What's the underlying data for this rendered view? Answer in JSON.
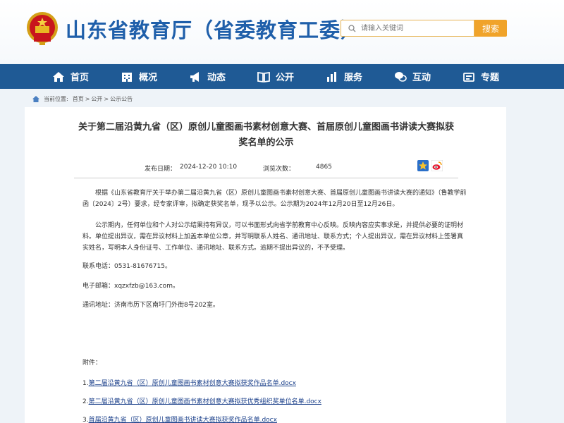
{
  "header": {
    "site_title": "山东省教育厅（省委教育工委）",
    "search_placeholder": "请输入关键词",
    "search_button": "搜索"
  },
  "nav": {
    "items": [
      {
        "label": "首页",
        "icon": "home-icon"
      },
      {
        "label": "概况",
        "icon": "building-icon"
      },
      {
        "label": "动态",
        "icon": "megaphone-icon"
      },
      {
        "label": "公开",
        "icon": "book-icon"
      },
      {
        "label": "服务",
        "icon": "chart-icon"
      },
      {
        "label": "互动",
        "icon": "chat-icon"
      },
      {
        "label": "专题",
        "icon": "flag-icon"
      }
    ]
  },
  "breadcrumb": {
    "prefix": "当前位置:",
    "items": [
      "首页",
      ">",
      "公开",
      ">",
      "公示公告"
    ]
  },
  "article": {
    "title": "关于第二届沿黄九省（区）原创儿童图画书素材创意大赛、首届原创儿童图画书讲读大赛拟获奖名单的公示",
    "date_label": "发布日期：",
    "date_value": "2024-12-20 10:10",
    "views_label": "浏览次数：",
    "views_value": "4865",
    "paragraphs": [
      "根据《山东省教育厅关于举办第二届沿黄九省（区）原创儿童图画书素材创意大赛、首届原创儿童图画书讲读大赛的通知》（鲁教学前函〔2024〕2号）要求，经专家评审，拟确定获奖名单，现予以公示。公示期为2024年12月20日至12月26日。",
      "公示期内，任何单位和个人对公示结果持有异议，可以书面形式向省学前教育中心反映。反映内容应实事求是，并提供必要的证明材料。单位提出异议，需在异议材料上加盖本单位公章，并写明联系人姓名、通讯地址、联系方式；个人提出异议，需在异议材料上签署真实姓名，写明本人身份证号、工作单位、通讯地址、联系方式。逾期不提出异议的，不予受理。"
    ],
    "phone": "联系电话：0531-81676715。",
    "email": "电子邮箱：xqzxfzb@163.com。",
    "address": "通讯地址：济南市历下区南圩门外街8号202室。",
    "attachments_label": "附件：",
    "attachments": [
      {
        "num": "1.",
        "name": "第二届沿黄九省（区）原创儿童图画书素材创意大赛拟获奖作品名单.docx"
      },
      {
        "num": "2.",
        "name": "第二届沿黄九省（区）原创儿童图画书素材创意大赛拟获优秀组织奖单位名单.docx"
      },
      {
        "num": "3.",
        "name": "首届沿黄九省（区）原创儿童图画书讲读大赛拟获奖作品名单.docx"
      }
    ]
  },
  "colors": {
    "brand_blue": "#1f5faa",
    "nav_bg": "#1f5a95",
    "search_accent": "#f0a32a",
    "link": "#1a3f8a"
  }
}
